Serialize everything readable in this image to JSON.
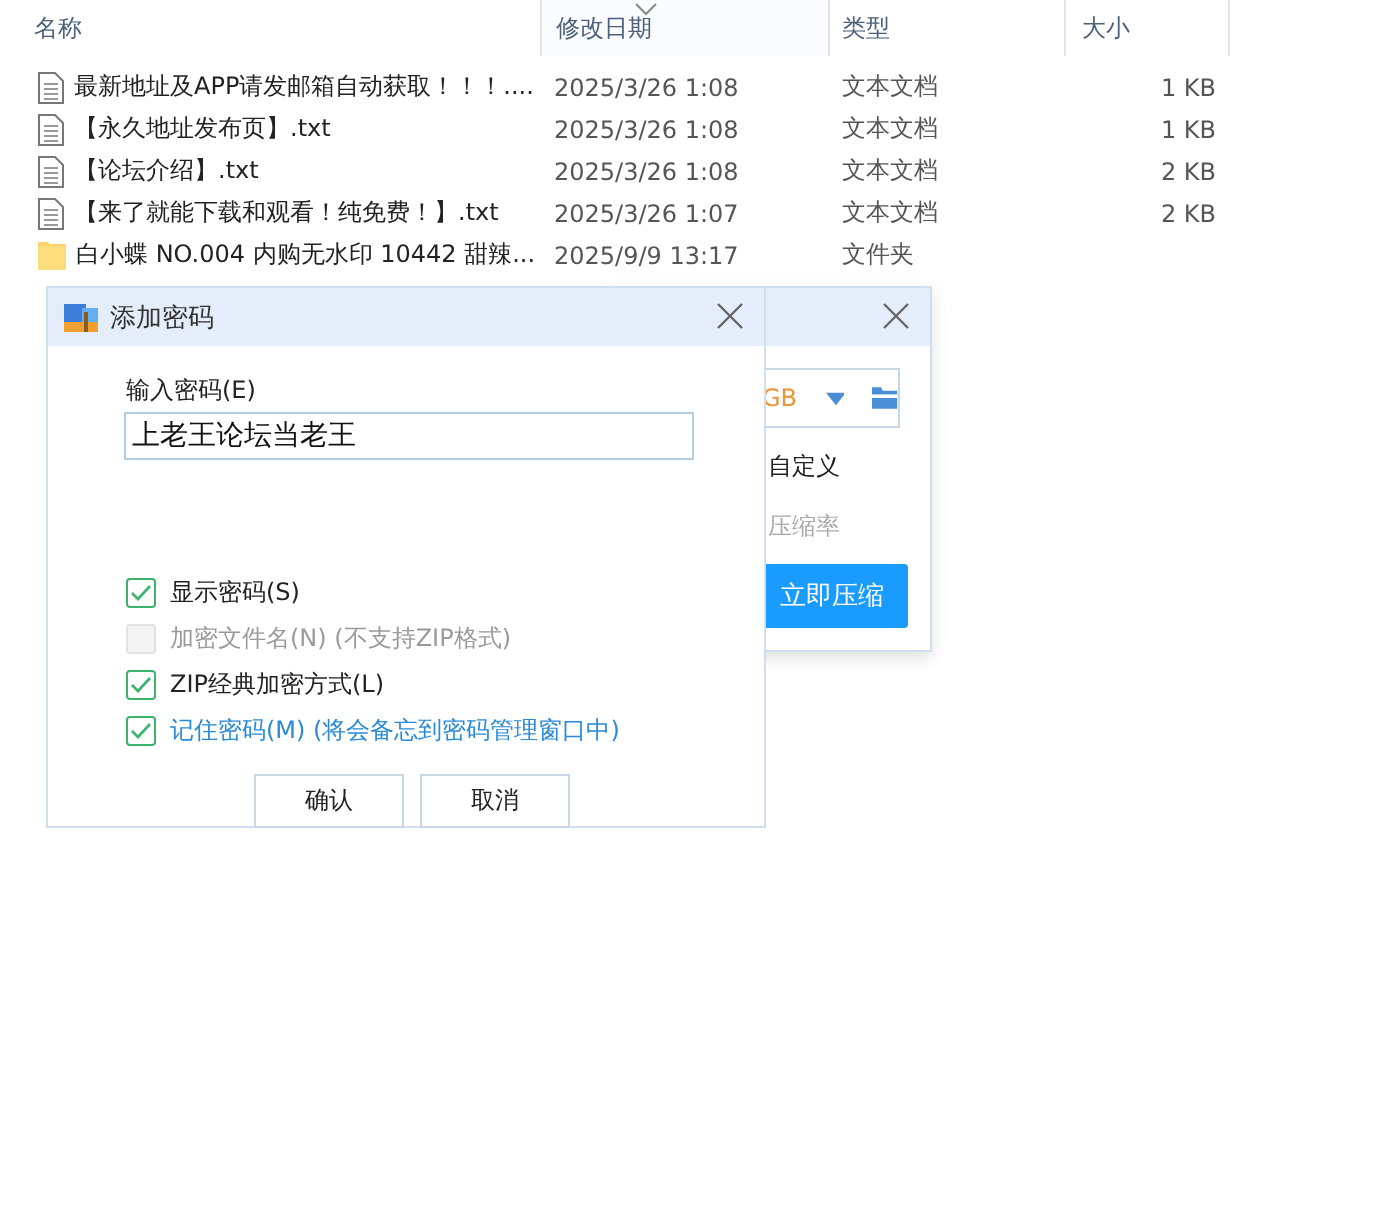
{
  "file_list": {
    "columns": [
      {
        "label": "名称",
        "sorted": false
      },
      {
        "label": "修改日期",
        "sorted": true
      },
      {
        "label": "类型",
        "sorted": false
      },
      {
        "label": "大小",
        "sorted": false
      }
    ],
    "rows": [
      {
        "kind": "text",
        "name": "最新地址及APP请发邮箱自动获取！！！....",
        "modified": "2025/3/26 1:08",
        "type": "文本文档",
        "size": "1 KB"
      },
      {
        "kind": "text",
        "name": "【永久地址发布页】.txt",
        "modified": "2025/3/26 1:08",
        "type": "文本文档",
        "size": "1 KB"
      },
      {
        "kind": "text",
        "name": "【论坛介绍】.txt",
        "modified": "2025/3/26 1:08",
        "type": "文本文档",
        "size": "2 KB"
      },
      {
        "kind": "text",
        "name": "【来了就能下载和观看！纯免费！】.txt",
        "modified": "2025/3/26 1:07",
        "type": "文本文档",
        "size": "2 KB"
      },
      {
        "kind": "folder",
        "name": "白小蝶 NO.004 内购无水印 10442 甜辣...",
        "modified": "2025/9/9 13:17",
        "type": "文件夹"
      }
    ]
  },
  "compress_dialog": {
    "size_value": "GB",
    "option": "自定义",
    "ratio_label": "压缩率",
    "button": "立即压缩"
  },
  "password_dialog": {
    "title": "添加密码",
    "password_label": "输入密码(E)",
    "password_value": "上老王论坛当老王",
    "options": [
      {
        "label": "显示密码(S)",
        "checked": true,
        "disabled": false,
        "accent": false
      },
      {
        "label": "加密文件名(N) (不支持ZIP格式)",
        "checked": false,
        "disabled": true,
        "accent": false
      },
      {
        "label": "ZIP经典加密方式(L)",
        "checked": true,
        "disabled": false,
        "accent": false
      },
      {
        "label": "记住密码(M) (将会备忘到密码管理窗口中)",
        "checked": true,
        "disabled": false,
        "accent": true
      }
    ],
    "buttons": [
      "确认",
      "取消"
    ]
  }
}
